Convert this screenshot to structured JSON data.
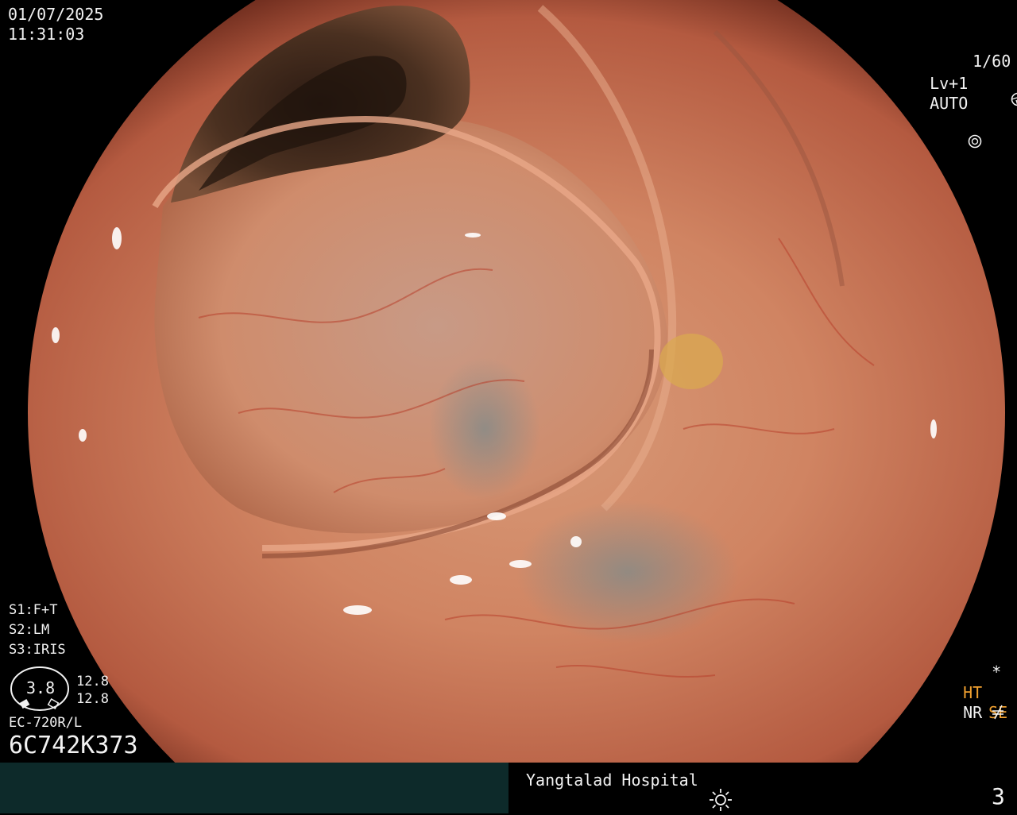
{
  "image": {
    "description_icon": "endoscopy-colon-view"
  },
  "top_left": {
    "date": "01/07/2025",
    "time": "11:31:03"
  },
  "top_right": {
    "shutter": "1/60",
    "shutter_icon": "aperture-icon",
    "level": "Lv+1",
    "mode": "AUTO",
    "mode_icon": "iris-icon"
  },
  "bottom_left": {
    "s1_label": "S1:",
    "s1_value": "F+T",
    "s2_label": "S2:",
    "s2_value": "LM",
    "s3_label": "S3:",
    "s3_value": "IRIS",
    "gauge_value": "3.8",
    "gauge_top": "12.8",
    "gauge_bottom": "12.8",
    "scope_model": "EC-720R/L",
    "serial": "6C742K373"
  },
  "bottom_right": {
    "star": "*",
    "ht": "HT",
    "nr": "NR",
    "se": "SE",
    "colors": {
      "accent": "#f0a030"
    }
  },
  "footer": {
    "hospital": "Yangtalad Hospital",
    "page_number": "3",
    "brightness_icon": "sun-icon"
  }
}
